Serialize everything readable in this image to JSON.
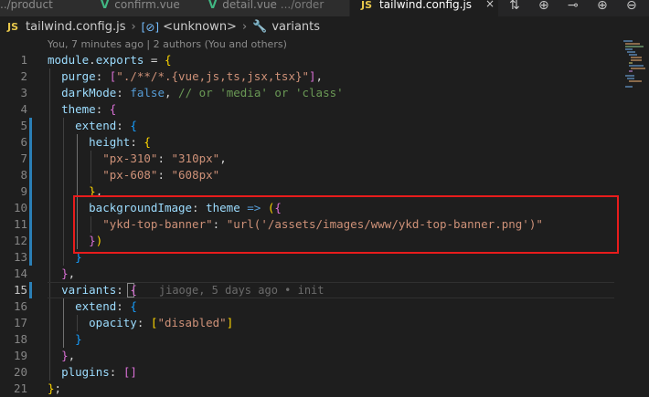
{
  "tabs": [
    {
      "label": "../product",
      "icon": "",
      "dir": "",
      "active": false
    },
    {
      "label": "confirm.vue",
      "icon": "V",
      "dir": "",
      "active": false
    },
    {
      "label": "detail.vue",
      "icon": "V",
      "dir": ".../order",
      "active": false
    },
    {
      "label": "tailwind.config.js",
      "icon": "JS",
      "dir": "",
      "active": true
    }
  ],
  "tab_close_glyph": "×",
  "breadcrumb": {
    "file_icon": "JS",
    "file": "tailwind.config.js",
    "separator": "›",
    "symbol_icon": "[⊘]",
    "symbol": "<unknown>",
    "wrench_icon": "🔧",
    "member": "variants"
  },
  "blame_header": "You, 7 minutes ago | 2 authors (You and others)",
  "ghost_blame": "jiaoge, 5 days ago • init",
  "lines": [
    {
      "n": "1",
      "code": "module.exports = {"
    },
    {
      "n": "2",
      "code": "  purge: [\"./**/*.{vue,js,ts,jsx,tsx}\"],"
    },
    {
      "n": "3",
      "code": "  darkMode: false, // or 'media' or 'class'"
    },
    {
      "n": "4",
      "code": "  theme: {"
    },
    {
      "n": "5",
      "code": "    extend: {"
    },
    {
      "n": "6",
      "code": "      height: {"
    },
    {
      "n": "7",
      "code": "        \"px-310\": \"310px\","
    },
    {
      "n": "8",
      "code": "        \"px-608\": \"608px\""
    },
    {
      "n": "9",
      "code": "      },"
    },
    {
      "n": "10",
      "code": "      backgroundImage: theme => ({"
    },
    {
      "n": "11",
      "code": "        \"ykd-top-banner\": \"url('/assets/images/www/ykd-top-banner.png')\""
    },
    {
      "n": "12",
      "code": "      })"
    },
    {
      "n": "13",
      "code": "    }"
    },
    {
      "n": "14",
      "code": "  },"
    },
    {
      "n": "15",
      "code": "  variants: {"
    },
    {
      "n": "16",
      "code": "    extend: {"
    },
    {
      "n": "17",
      "code": "      opacity: [\"disabled\"]"
    },
    {
      "n": "18",
      "code": "    }"
    },
    {
      "n": "19",
      "code": "  },"
    },
    {
      "n": "20",
      "code": "  plugins: []"
    },
    {
      "n": "21",
      "code": "};"
    }
  ],
  "colors": {
    "highlight_box": "#e81c1c",
    "editor_bg": "#1e1e1e",
    "vue_icon": "#41b883",
    "js_icon": "#e8c84b"
  },
  "toolbar_icons": [
    "compare-changes-icon",
    "git-previous-icon",
    "git-commit-icon",
    "git-next-icon",
    "open-changes-icon"
  ]
}
